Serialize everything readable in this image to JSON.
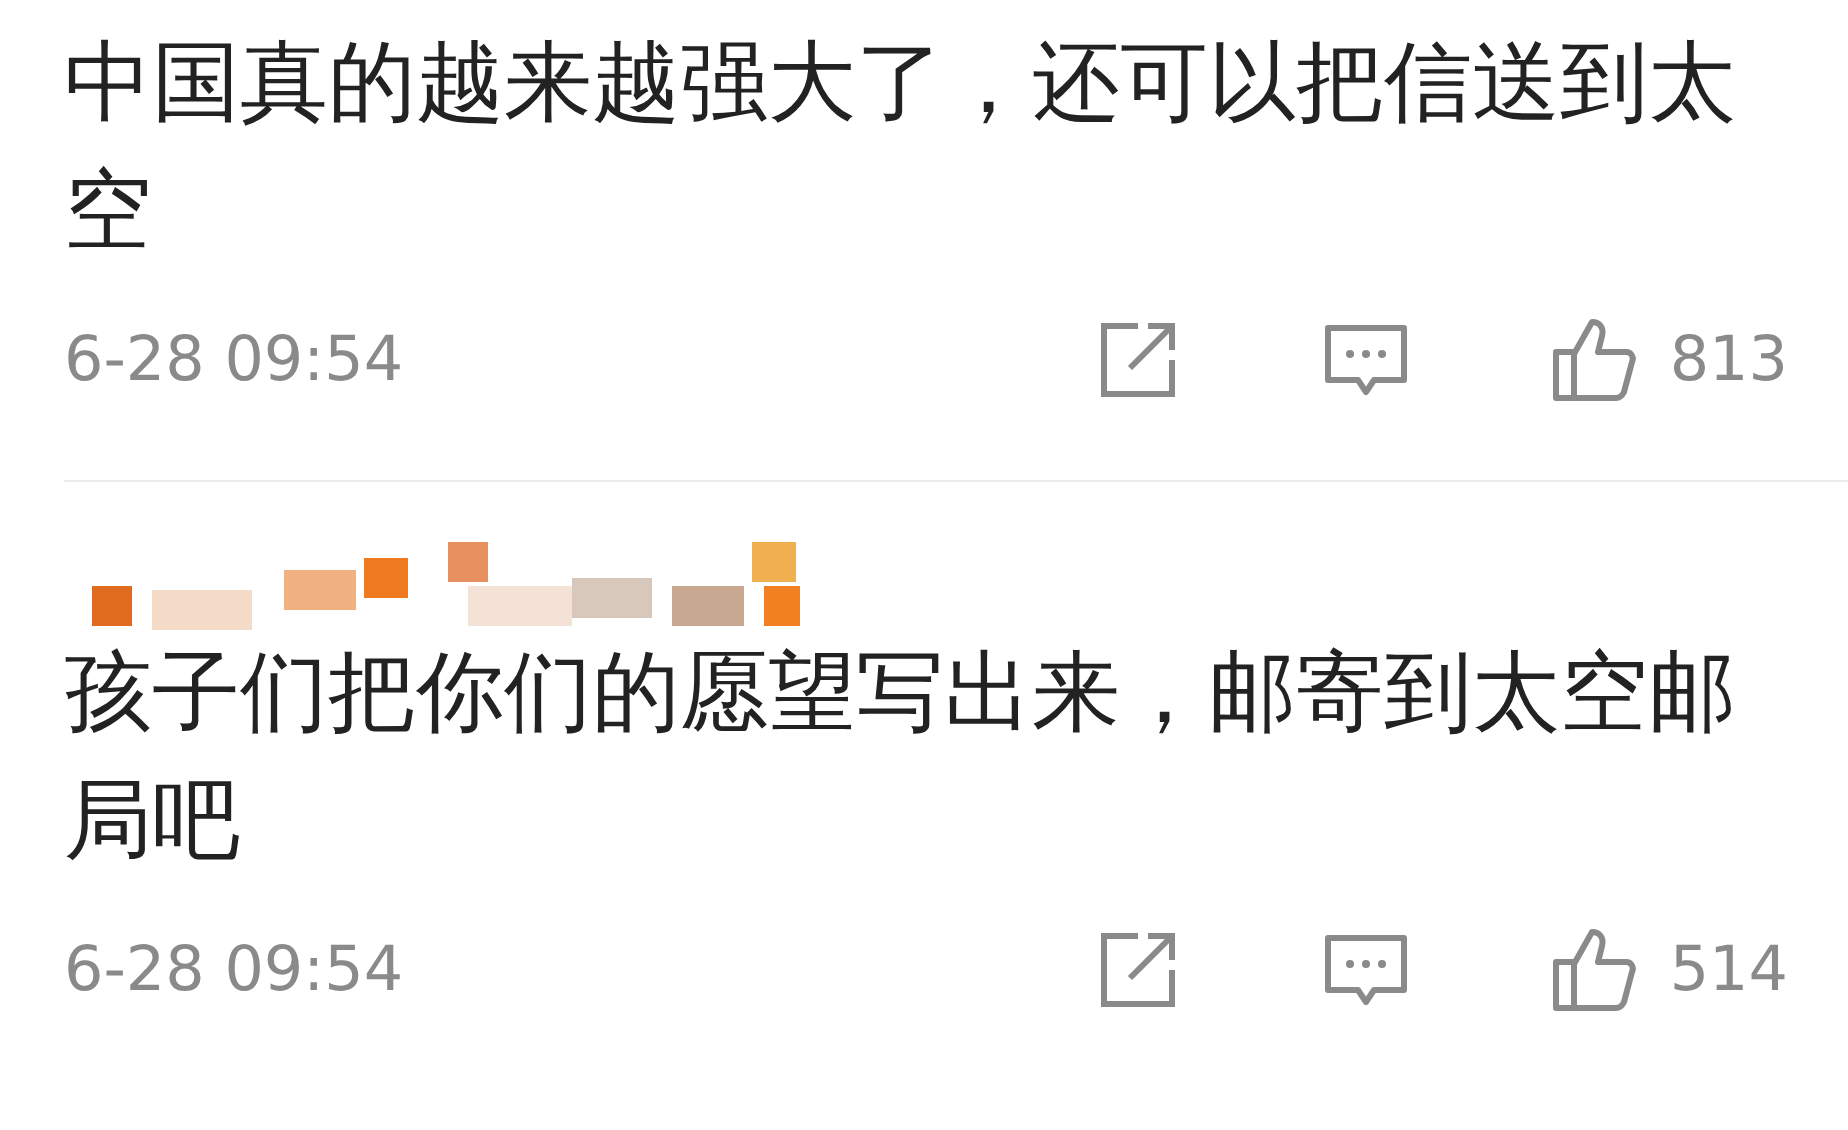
{
  "comments": [
    {
      "text": "中国真的越来越强大了，还可以把信送到太空",
      "time": "6-28 09:54",
      "likes": "813"
    },
    {
      "text": "孩子们把你们的愿望写出来，邮寄到太空邮局吧",
      "time": "6-28 09:54",
      "likes": "514"
    }
  ]
}
